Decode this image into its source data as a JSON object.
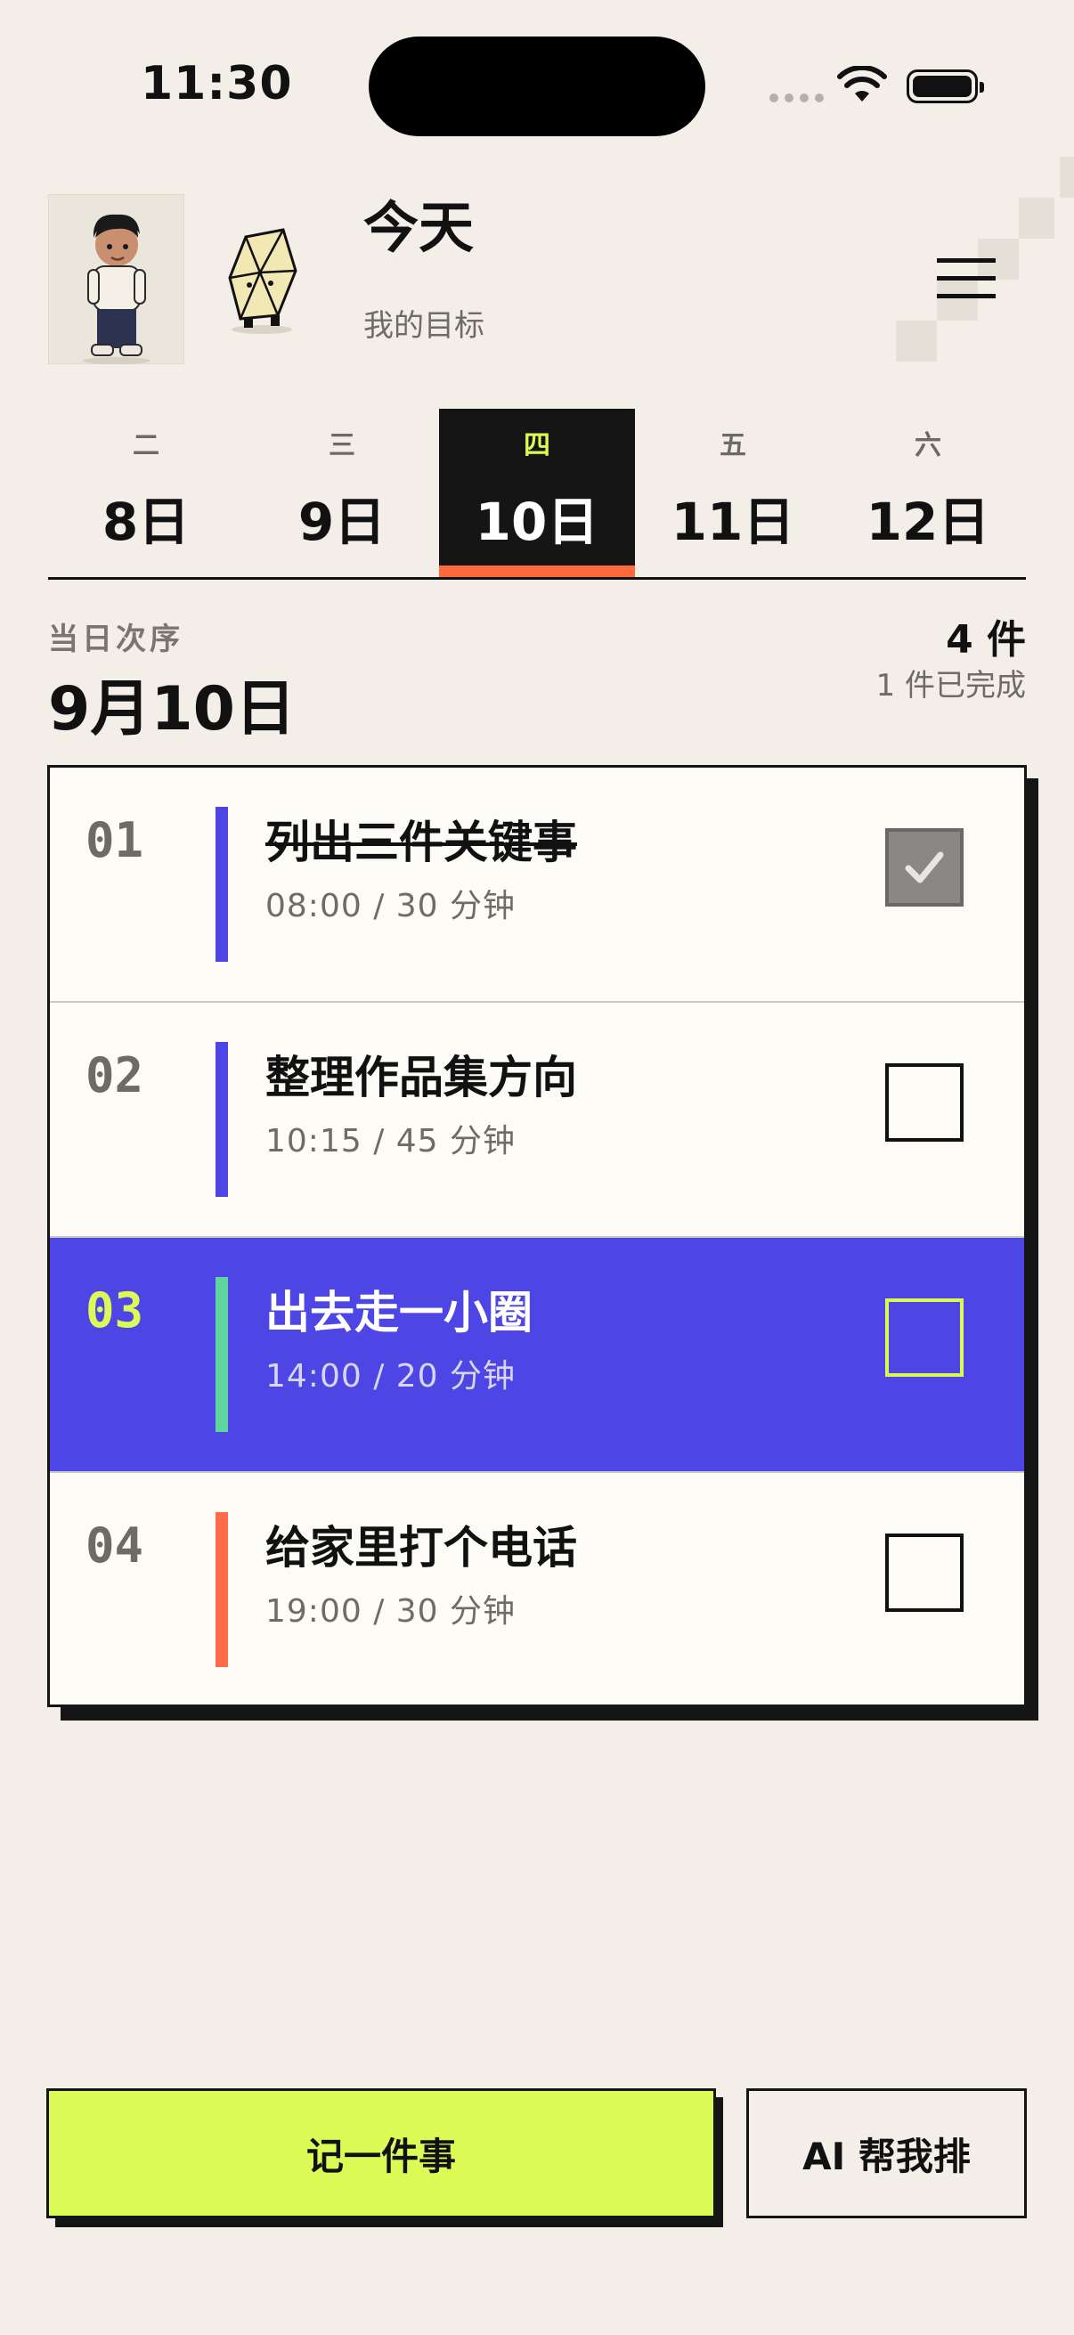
{
  "status_bar": {
    "time": "11:30"
  },
  "header": {
    "title": "今天",
    "subtitle": "我的目标"
  },
  "days": [
    {
      "weekday": "二",
      "date": "8日",
      "active": false
    },
    {
      "weekday": "三",
      "date": "9日",
      "active": false
    },
    {
      "weekday": "四",
      "date": "10日",
      "active": true
    },
    {
      "weekday": "五",
      "date": "11日",
      "active": false
    },
    {
      "weekday": "六",
      "date": "12日",
      "active": false
    }
  ],
  "section": {
    "label": "当日次序",
    "date": "9月10日",
    "count": "4 件",
    "done": "1 件已完成"
  },
  "tasks": [
    {
      "num": "01",
      "title": "列出三件关键事",
      "meta": "08:00 / 30 分钟",
      "done": true,
      "highlight": false,
      "color": "#4d45e4"
    },
    {
      "num": "02",
      "title": "整理作品集方向",
      "meta": "10:15 / 45 分钟",
      "done": false,
      "highlight": false,
      "color": "#4d45e4"
    },
    {
      "num": "03",
      "title": "出去走一小圈",
      "meta": "14:00 / 20 分钟",
      "done": false,
      "highlight": true,
      "color": "#5fd6a0"
    },
    {
      "num": "04",
      "title": "给家里打个电话",
      "meta": "19:00 / 30 分钟",
      "done": false,
      "highlight": false,
      "color": "#ff6a48"
    }
  ],
  "buttons": {
    "add": "记一件事",
    "ai": "AI 帮我排"
  },
  "colors": {
    "background": "#f3efe8",
    "accent_lime": "#dcfa56",
    "accent_indigo": "#4d45e4",
    "accent_orange": "#ff6a3d"
  },
  "icons": [
    "wifi-icon",
    "battery-icon",
    "menu-icon",
    "check-icon"
  ]
}
